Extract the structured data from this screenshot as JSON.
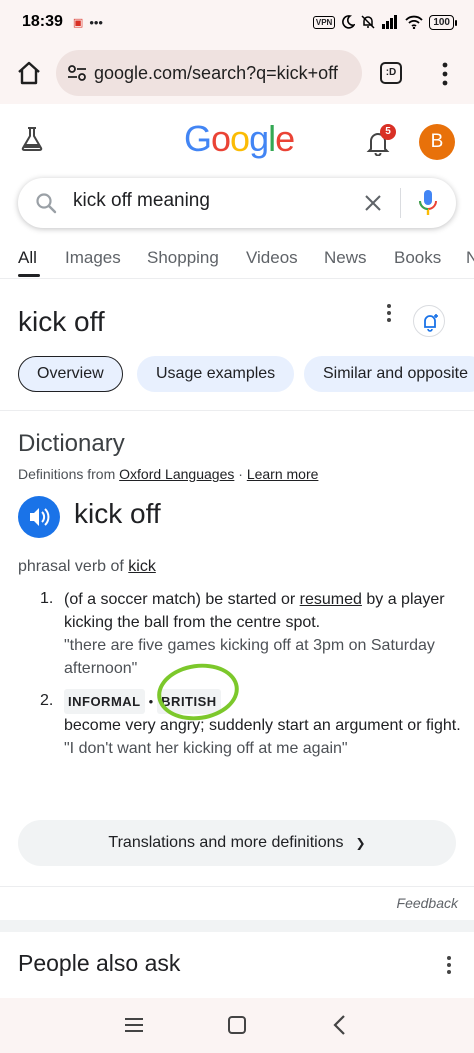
{
  "status_bar": {
    "time": "18:39",
    "dots": "•••",
    "vpn": "VPN",
    "battery": "100"
  },
  "browser": {
    "url": "google.com/search?q=kick+off",
    "tab_icon": ":D"
  },
  "google": {
    "logo": "Google",
    "notification_count": "5",
    "avatar_letter": "B"
  },
  "search": {
    "query": "kick off meaning"
  },
  "tabs": [
    "All",
    "Images",
    "Shopping",
    "Videos",
    "News",
    "Books",
    "N"
  ],
  "topic": {
    "title": "kick off",
    "chips": [
      "Overview",
      "Usage examples",
      "Similar and opposite"
    ]
  },
  "dictionary": {
    "heading": "Dictionary",
    "source_prefix": "Definitions from ",
    "source_name": "Oxford Languages",
    "source_sep": " · ",
    "learn_more": "Learn more",
    "word": "kick off",
    "pos_prefix": "phrasal verb of ",
    "pos_root": "kick",
    "definitions": [
      {
        "num": "1.",
        "text_a": "(of a soccer match) be started or ",
        "text_link": "resumed",
        "text_b": " by a player kicking the ball from the centre spot.",
        "example": "\"there are five games kicking off at 3pm on Saturday afternoon\""
      },
      {
        "num": "2.",
        "tag1": "INFORMAL",
        "tag_dot": "•",
        "tag2": "BRITISH",
        "text": "become very angry; suddenly start an argument or fight.",
        "example": "\"I don't want her kicking off at me again\""
      }
    ],
    "more_button": "Translations and more definitions"
  },
  "feedback": "Feedback",
  "people_also_ask": "People also ask",
  "colors": {
    "accent": "#1a73e8",
    "annotation": "#7cc82b",
    "avatar": "#e8710a",
    "badge": "#d93025"
  }
}
